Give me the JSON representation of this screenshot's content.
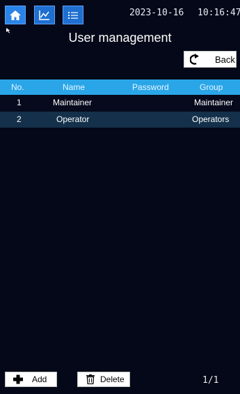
{
  "topbar": {
    "date": "2023-10-16",
    "time": "10:16:47",
    "icons": [
      "home-icon",
      "chart-icon",
      "list-icon"
    ]
  },
  "page": {
    "title": "User management"
  },
  "back_button": {
    "label": "Back",
    "icon": "back-arrow-icon"
  },
  "table": {
    "headers": {
      "no": "No.",
      "name": "Name",
      "password": "Password",
      "group": "Group"
    },
    "rows": [
      {
        "no": "1",
        "name": "Maintainer",
        "password": "",
        "group": "Maintainer"
      },
      {
        "no": "2",
        "name": "Operator",
        "password": "",
        "group": "Operators"
      }
    ],
    "selected_row": 2
  },
  "actions": {
    "add_label": "Add",
    "delete_label": "Delete"
  },
  "pager": {
    "text": "1/1"
  },
  "colors": {
    "background": "#050818",
    "header": "#2aa6e8",
    "selected_row": "#14304a",
    "nav_button": "#1e6fd0"
  }
}
